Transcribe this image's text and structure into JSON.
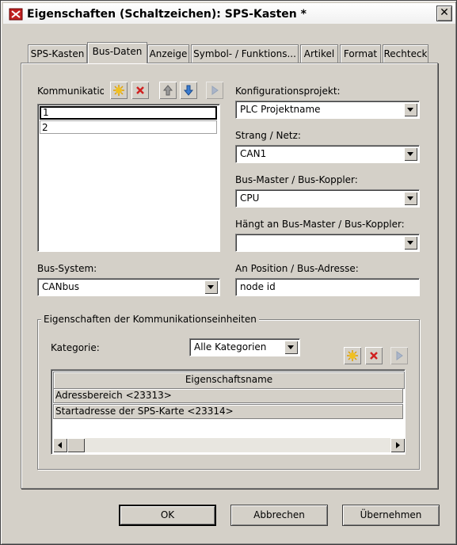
{
  "window": {
    "title": "Eigenschaften (Schaltzeichen): SPS-Kasten *",
    "close_symbol": "✕"
  },
  "tabs": [
    {
      "label": "SPS-Kasten"
    },
    {
      "label": "Bus-Daten"
    },
    {
      "label": "Anzeige"
    },
    {
      "label": "Symbol- / Funktions..."
    },
    {
      "label": "Artikel"
    },
    {
      "label": "Format"
    },
    {
      "label": "Rechteck"
    }
  ],
  "active_tab": "Bus-Daten",
  "left": {
    "kommunikation_label": "Kommunikatior",
    "toolbar_icons": [
      "new-icon",
      "delete-icon",
      "move-up-icon",
      "move-down-icon",
      "more-icon"
    ],
    "list_items": [
      "1",
      "2"
    ],
    "bus_system_label": "Bus-System:",
    "bus_system_value": "CANbus"
  },
  "right": {
    "konfig_label": "Konfigurationsprojekt:",
    "konfig_value": "PLC Projektname",
    "strang_label": "Strang / Netz:",
    "strang_value": "CAN1",
    "master_label": "Bus-Master / Bus-Koppler:",
    "master_value": "CPU",
    "haengt_label": "Hängt an Bus-Master / Bus-Koppler:",
    "haengt_value": "",
    "position_label": "An Position / Bus-Adresse:",
    "position_value": "node id"
  },
  "group": {
    "title": "Eigenschaften der Kommunikationseinheiten",
    "kategorie_label": "Kategorie:",
    "kategorie_value": "Alle Kategorien",
    "grid_header": "Eigenschaftsname",
    "grid_rows": [
      "Adressbereich <23313>",
      "Startadresse der SPS-Karte <23314>"
    ]
  },
  "buttons": {
    "ok": "OK",
    "cancel": "Abbrechen",
    "apply": "Übernehmen"
  },
  "colors": {
    "dialog_bg": "#d4d0c8",
    "field_bg": "#ffffff",
    "border_dark": "#808080",
    "star_yellow": "#f0c020",
    "delete_red": "#d02020",
    "arrow_blue": "#3a7cd0"
  }
}
